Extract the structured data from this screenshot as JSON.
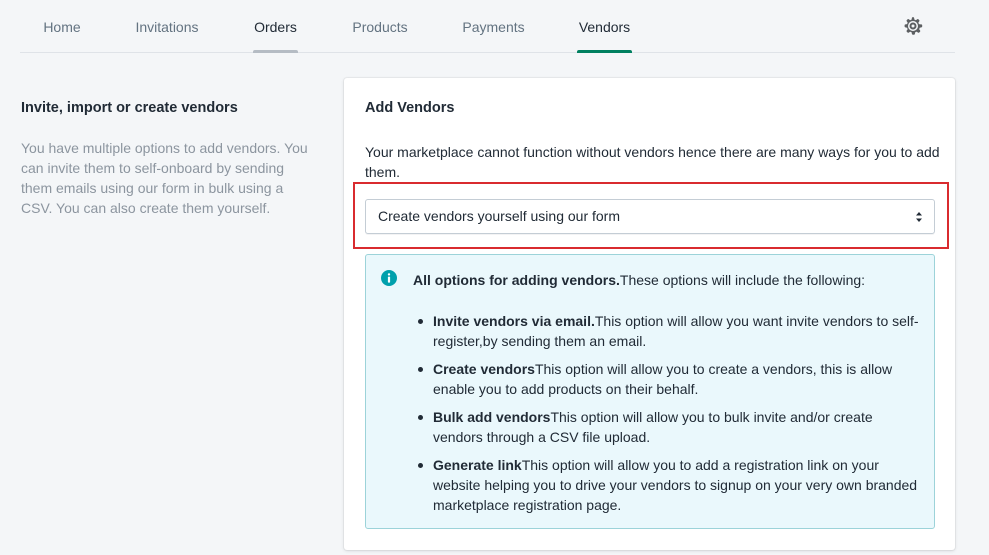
{
  "nav": {
    "tabs": [
      {
        "label": "Home"
      },
      {
        "label": "Invitations"
      },
      {
        "label": "Orders"
      },
      {
        "label": "Products"
      },
      {
        "label": "Payments"
      },
      {
        "label": "Vendors"
      }
    ],
    "settings_icon": "gear-icon",
    "hover_tab": "Orders",
    "active_tab": "Vendors",
    "active_color": "#008060",
    "hover_color": "#b5bcc4"
  },
  "left": {
    "title": "Invite, import or create vendors",
    "description": "You have multiple options to add vendors. You can invite them to self-onboard by sending them emails using our form in bulk using a CSV. You can also create them yourself."
  },
  "card": {
    "title": "Add Vendors",
    "description": "Your marketplace cannot function without vendors hence there are many ways for you to add them.",
    "select_value": "Create vendors yourself using our form",
    "highlight_color": "#d92b2f"
  },
  "banner": {
    "icon": "info-icon",
    "icon_color": "#00a0ac",
    "heading_bold": "All options for adding vendors.",
    "heading_rest": "These options will include the following:",
    "items": [
      {
        "bold": "Invite vendors via email.",
        "text": "This option will allow you want invite vendors to self-register,by sending them an email."
      },
      {
        "bold": "Create vendors",
        "text": "This option will allow you to create a vendors, this is allow enable you to add products on their behalf."
      },
      {
        "bold": "Bulk add vendors",
        "text": "This option will allow you to bulk invite and/or create vendors through a CSV file upload."
      },
      {
        "bold": "Generate link",
        "text": "This option will allow you to add a registration link on your website helping you to drive your vendors to signup on your very own branded marketplace registration page."
      }
    ]
  }
}
